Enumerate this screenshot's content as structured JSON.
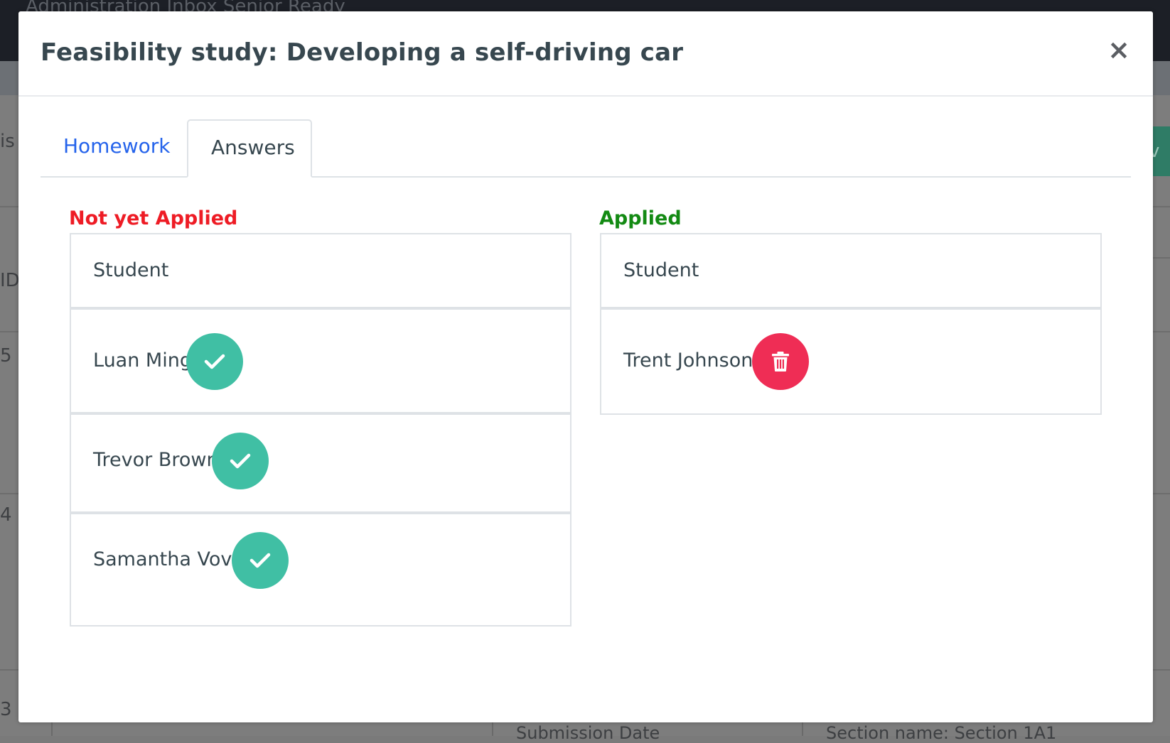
{
  "background": {
    "topbar_text": "Administration Inbox    Senior Ready",
    "edge_texts": [
      "is",
      "ID",
      "5",
      "4",
      "3"
    ],
    "right_button_text": "ev",
    "bottom_texts": [
      "Submission Date",
      "Section name: Section 1A1"
    ]
  },
  "modal": {
    "title": "Feasibility study: Developing a self-driving car",
    "close_label": "×"
  },
  "tabs": [
    {
      "label": "Homework",
      "active": false
    },
    {
      "label": "Answers",
      "active": true
    }
  ],
  "not_applied": {
    "label": "Not yet Applied",
    "column_header": "Student",
    "students": [
      {
        "name": "Luan Ming",
        "action_icon": "check-icon"
      },
      {
        "name": "Trevor Brown",
        "action_icon": "check-icon"
      },
      {
        "name": "Samantha Vovo",
        "action_icon": "check-icon"
      }
    ]
  },
  "applied": {
    "label": "Applied",
    "column_header": "Student",
    "students": [
      {
        "name": "Trent Johnson",
        "action_icon": "trash-icon"
      }
    ]
  },
  "colors": {
    "primary_link": "#2563eb",
    "not_applied": "#ee1c25",
    "applied": "#138a13",
    "check_button": "#40bfa4",
    "delete_button": "#ef2d55"
  }
}
